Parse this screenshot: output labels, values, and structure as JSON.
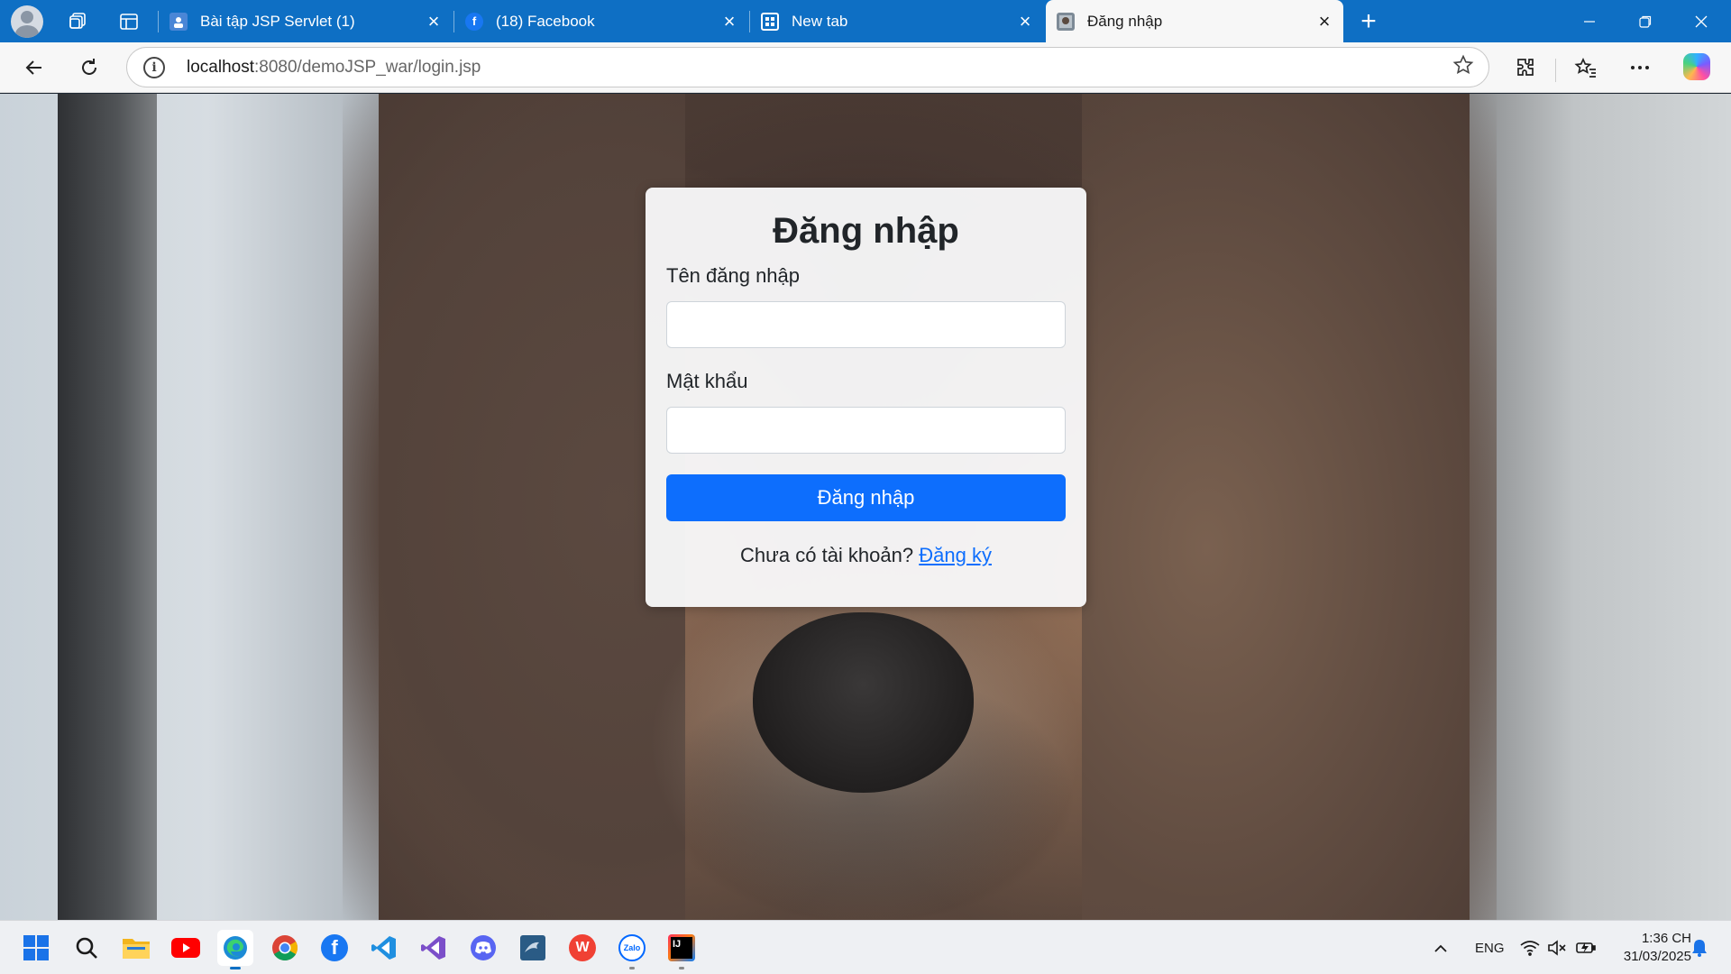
{
  "browser": {
    "tabs": [
      {
        "title": "Bài tập JSP Servlet (1)",
        "favicon": "user-icon",
        "active": false
      },
      {
        "title": "(18) Facebook",
        "favicon": "facebook-icon",
        "active": false
      },
      {
        "title": "New tab",
        "favicon": "newtab-icon",
        "active": false
      },
      {
        "title": "Đăng nhập",
        "favicon": "page-icon",
        "active": true
      }
    ],
    "new_tab_label": "+",
    "url_host": "localhost",
    "url_path": ":8080/demoJSP_war/login.jsp",
    "info_icon": "i"
  },
  "login": {
    "title": "Đăng nhập",
    "username_label": "Tên đăng nhập",
    "username_value": "",
    "password_label": "Mật khẩu",
    "password_value": "",
    "submit_label": "Đăng nhập",
    "register_prompt": "Chưa có tài khoản?",
    "register_link": "Đăng ký"
  },
  "taskbar": {
    "apps": [
      "start",
      "search",
      "file-explorer",
      "youtube",
      "edge",
      "chrome",
      "facebook",
      "vscode",
      "visual-studio",
      "discord",
      "mysql-workbench",
      "wps",
      "zalo",
      "intellij"
    ],
    "zalo_label": "Zalo",
    "wps_label": "W",
    "ij_label": "IJ",
    "tray": {
      "language": "ENG",
      "time": "1:36 CH",
      "date": "31/03/2025"
    }
  },
  "colors": {
    "titlebar": "#0e6fc4",
    "primary_button": "#0d6efd",
    "link": "#0d6efd"
  }
}
